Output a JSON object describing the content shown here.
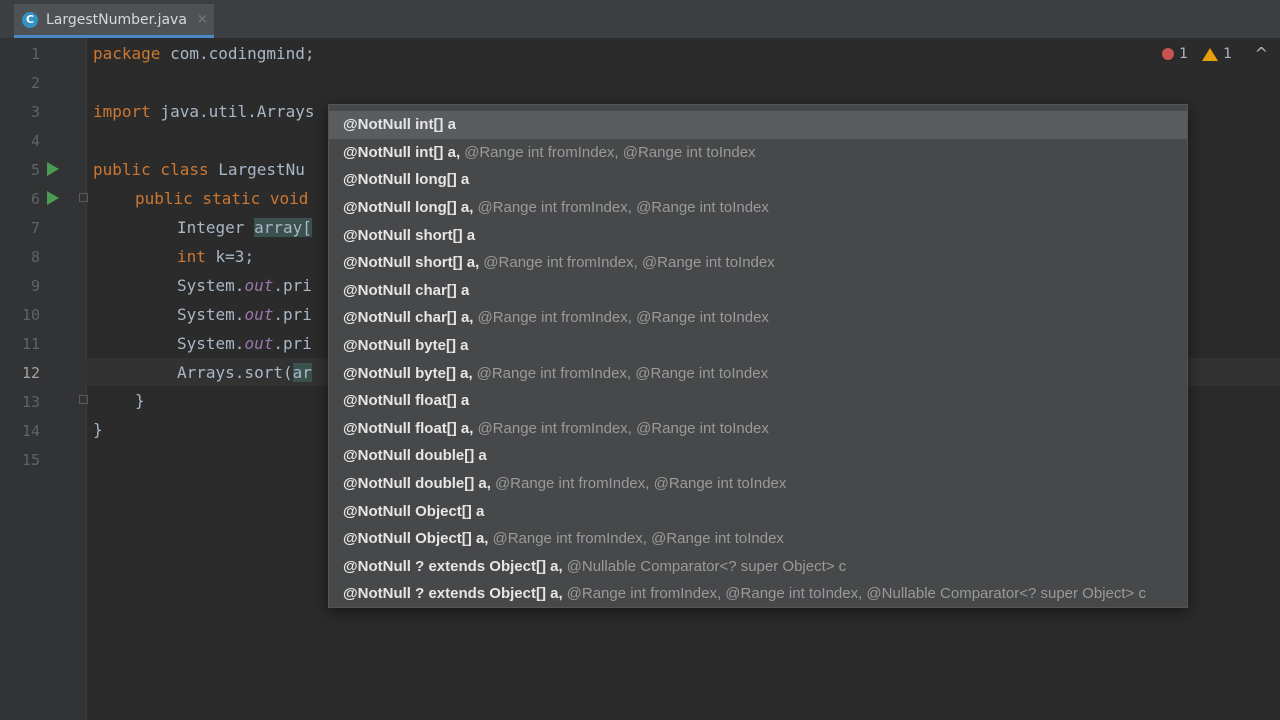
{
  "tab": {
    "filename": "LargestNumber.java",
    "file_icon": "C",
    "close": "×"
  },
  "inspections": {
    "errors": "1",
    "warnings": "1",
    "collapse": "^"
  },
  "gutter": {
    "line_numbers": [
      "1",
      "2",
      "3",
      "4",
      "5",
      "6",
      "7",
      "8",
      "9",
      "10",
      "11",
      "12",
      "13",
      "14",
      "15"
    ]
  },
  "code": {
    "l1_kw": "package",
    "l1_rest": " com.codingmind;",
    "l3_kw": "import",
    "l3_rest": " java.util.Arrays",
    "l5_kw": "public class",
    "l5_rest": " LargestNu",
    "l6_kw": "public static void",
    "l6_rest": "",
    "l7_type": "Integer ",
    "l7_var": "array[",
    "l8_kw": "int",
    "l8_rest": " k=3;",
    "l9_a": "System.",
    "l9_out": "out",
    "l9_b": ".pri",
    "l10_a": "System.",
    "l10_out": "out",
    "l10_b": ".pri",
    "l11_a": "System.",
    "l11_out": "out",
    "l11_b": ".pri",
    "l12_a": "Arrays.sort(",
    "l12_arg": "ar",
    "l13": "}",
    "l14": "}"
  },
  "completion": {
    "items": [
      {
        "main": "@NotNull int[] a",
        "rest": ""
      },
      {
        "main": "@NotNull int[] a,",
        "rest": "@Range int fromIndex, @Range int toIndex"
      },
      {
        "main": "@NotNull long[] a",
        "rest": ""
      },
      {
        "main": "@NotNull long[] a,",
        "rest": "@Range int fromIndex, @Range int toIndex"
      },
      {
        "main": "@NotNull short[] a",
        "rest": ""
      },
      {
        "main": "@NotNull short[] a,",
        "rest": "@Range int fromIndex, @Range int toIndex"
      },
      {
        "main": "@NotNull char[] a",
        "rest": ""
      },
      {
        "main": "@NotNull char[] a,",
        "rest": "@Range int fromIndex, @Range int toIndex"
      },
      {
        "main": "@NotNull byte[] a",
        "rest": ""
      },
      {
        "main": "@NotNull byte[] a,",
        "rest": "@Range int fromIndex, @Range int toIndex"
      },
      {
        "main": "@NotNull float[] a",
        "rest": ""
      },
      {
        "main": "@NotNull float[] a,",
        "rest": "@Range int fromIndex, @Range int toIndex"
      },
      {
        "main": "@NotNull double[] a",
        "rest": ""
      },
      {
        "main": "@NotNull double[] a,",
        "rest": "@Range int fromIndex, @Range int toIndex"
      },
      {
        "main": "@NotNull Object[] a",
        "rest": ""
      },
      {
        "main": "@NotNull Object[] a,",
        "rest": "@Range int fromIndex, @Range int toIndex"
      },
      {
        "main": "@NotNull ? extends Object[] a,",
        "rest": "@Nullable Comparator<? super Object> c"
      },
      {
        "main": "@NotNull ? extends Object[] a,",
        "rest": "@Range int fromIndex, @Range int toIndex, @Nullable Comparator<? super Object> c"
      }
    ]
  }
}
